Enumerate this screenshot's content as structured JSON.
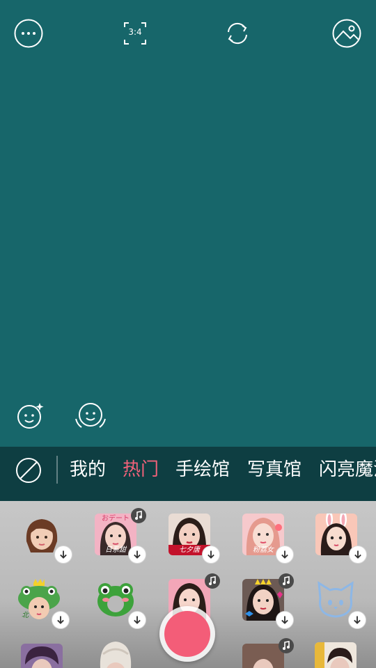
{
  "camera": {
    "aspect_ratio": "3:4",
    "top_icons": [
      "more-options-icon",
      "aspect-ratio-icon",
      "switch-camera-icon",
      "gallery-icon"
    ],
    "beauty_icons": [
      "beauty-sparkle-icon",
      "face-slim-icon"
    ]
  },
  "tabs": {
    "items": [
      {
        "label": "我的",
        "active": false
      },
      {
        "label": "热门",
        "active": true
      },
      {
        "label": "手绘馆",
        "active": false
      },
      {
        "label": "写真馆",
        "active": false
      },
      {
        "label": "闪亮魔法",
        "active": false
      }
    ]
  },
  "stickers": {
    "captions": {
      "r1c2_top": "おデート",
      "r1c2": "日系甜",
      "r1c3": "七夕唐",
      "r1c4": "粉荔女",
      "r2c1": "北"
    }
  },
  "colors": {
    "preview_bg": "#17666A",
    "tab_bar_bg": "#0E3E42",
    "active_tab": "#F2627A",
    "shutter": "#F35D78"
  }
}
